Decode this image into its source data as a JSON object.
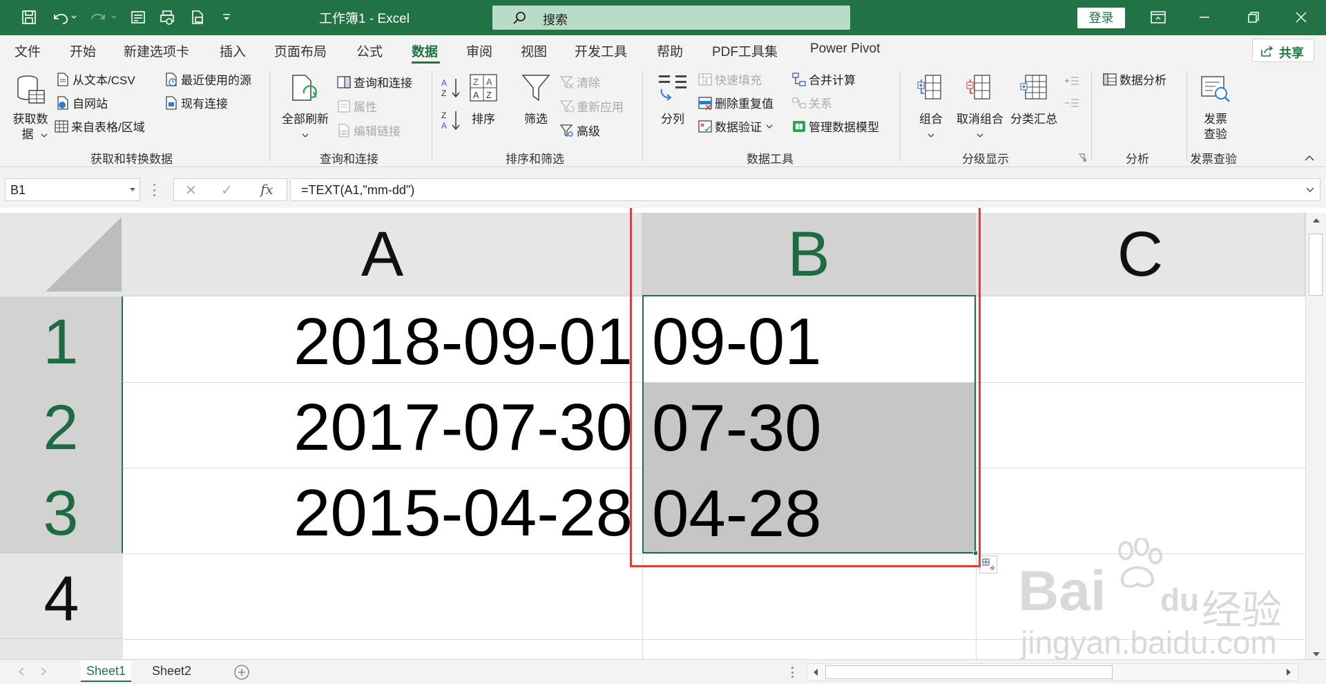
{
  "window": {
    "title": "工作簿1  -  Excel",
    "search_placeholder": "搜索",
    "login_label": "登录"
  },
  "tabs": [
    "文件",
    "开始",
    "新建选项卡",
    "插入",
    "页面布局",
    "公式",
    "数据",
    "审阅",
    "视图",
    "开发工具",
    "帮助",
    "PDF工具集",
    "Power Pivot"
  ],
  "active_tab": "数据",
  "share_label": "共享",
  "ribbon": {
    "get_data": {
      "big_label_1": "获取数",
      "big_label_2": "据",
      "from_text": "从文本/CSV",
      "from_web": "自网站",
      "from_table": "来自表格/区域",
      "recent_sources": "最近使用的源",
      "existing_conn": "现有连接",
      "group": "获取和转换数据"
    },
    "queries": {
      "refresh_all": "全部刷新",
      "queries_conn": "查询和连接",
      "properties": "属性",
      "edit_links": "编辑链接",
      "group": "查询和连接"
    },
    "sort_filter": {
      "sort": "排序",
      "filter": "筛选",
      "clear": "清除",
      "reapply": "重新应用",
      "advanced": "高级",
      "group": "排序和筛选"
    },
    "data_tools": {
      "text_to_columns": "分列",
      "flash_fill": "快速填充",
      "remove_dupes": "删除重复值",
      "validation": "数据验证",
      "consolidate": "合并计算",
      "relationships": "关系",
      "manage_model": "管理数据模型",
      "group": "数据工具"
    },
    "outline": {
      "group_btn": "组合",
      "ungroup_btn": "取消组合",
      "subtotal": "分类汇总",
      "group": "分级显示"
    },
    "analysis": {
      "data_analysis": "数据分析",
      "group": "分析"
    },
    "invoice": {
      "label_1": "发票",
      "label_2": "查验",
      "group": "发票查验"
    }
  },
  "formula_bar": {
    "name_box": "B1",
    "formula": "=TEXT(A1,\"mm-dd\")"
  },
  "sheet": {
    "columns": [
      "A",
      "B",
      "C"
    ],
    "rows": [
      "1",
      "2",
      "3",
      "4"
    ],
    "cells": {
      "A1": "2018-09-01",
      "B1": "09-01",
      "A2": "2017-07-30",
      "B2": "07-30",
      "A3": "2015-04-28",
      "B3": "04-28"
    }
  },
  "sheet_tabs": [
    "Sheet1",
    "Sheet2"
  ],
  "watermark": {
    "brand": "Bai",
    "brand2": "du",
    "cn": "经验",
    "url": "jingyan.baidu.com"
  }
}
